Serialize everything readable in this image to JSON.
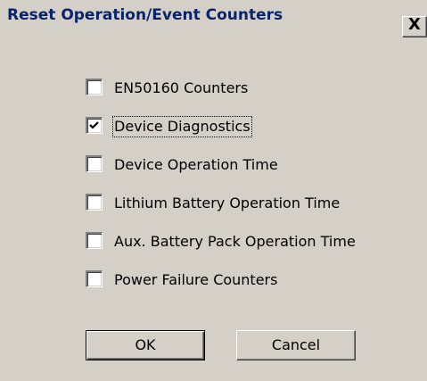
{
  "dialog": {
    "title": "Reset Operation/Event Counters",
    "close_icon": "close-icon",
    "close_glyph": "X"
  },
  "options": [
    {
      "label": "EN50160 Counters",
      "checked": false
    },
    {
      "label": "Device Diagnostics",
      "checked": true,
      "focused": true
    },
    {
      "label": "Device Operation Time",
      "checked": false
    },
    {
      "label": "Lithium Battery Operation Time",
      "checked": false
    },
    {
      "label": "Aux. Battery Pack Operation Time",
      "checked": false
    },
    {
      "label": "Power Failure Counters",
      "checked": false
    }
  ],
  "buttons": {
    "ok_label": "OK",
    "cancel_label": "Cancel"
  },
  "colors": {
    "face": "#d4d0c8",
    "title_text": "#0a246a"
  }
}
